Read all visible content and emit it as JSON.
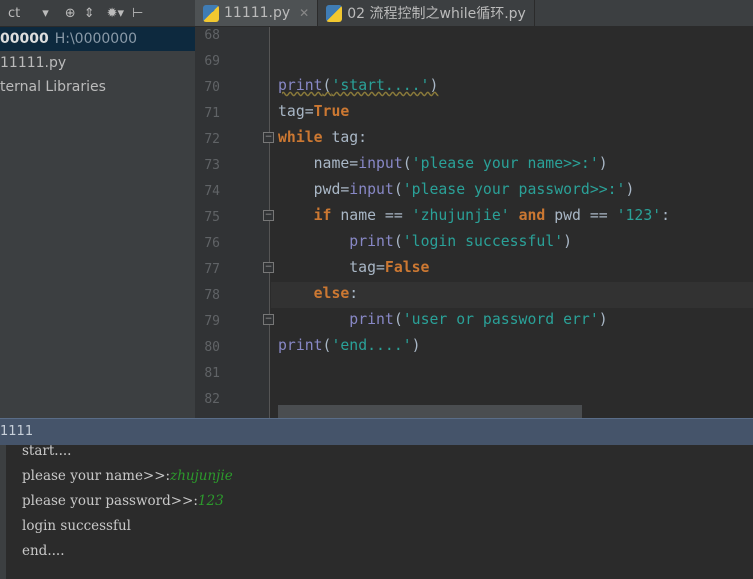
{
  "sidebar": {
    "dropdown_label": "ct",
    "project_name": "00000",
    "project_path": "H:\\0000000",
    "items": [
      "11111.py",
      "ternal Libraries"
    ]
  },
  "tabs": [
    {
      "label": "11111.py",
      "active": true
    },
    {
      "label": "02 流程控制之while循环.py",
      "active": false
    }
  ],
  "editor": {
    "line_numbers": [
      "68",
      "69",
      "70",
      "71",
      "72",
      "73",
      "74",
      "75",
      "76",
      "77",
      "78",
      "79",
      "80",
      "81",
      "82"
    ],
    "colors": {
      "keyword": "#cc7832",
      "string": "#2aa198",
      "builtin": "#8888c6",
      "text": "#a9b7c6"
    }
  },
  "run": {
    "title": "1111",
    "output": [
      "start....",
      "please your name>>:",
      "please your password>>:",
      "login successful",
      "end...."
    ],
    "inputs": [
      "zhujunjie",
      "123"
    ]
  }
}
